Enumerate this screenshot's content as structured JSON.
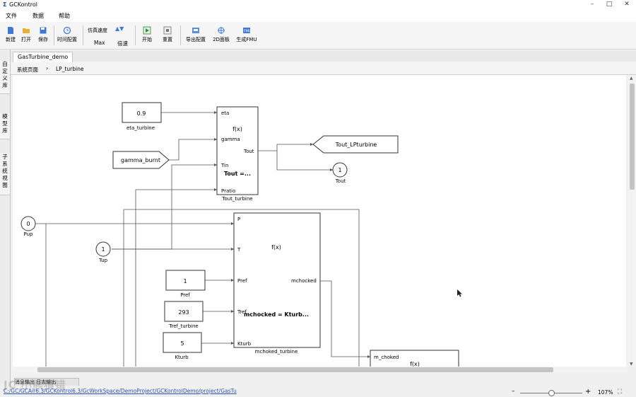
{
  "window": {
    "title": "GCKontrol",
    "app_icon": "Σ"
  },
  "menu": [
    "文件",
    "数据",
    "帮助"
  ],
  "toolbar": {
    "new": "新建",
    "open": "打开",
    "save": "保存",
    "time_config": "时间配置",
    "sim_speed_label": "仿真速度",
    "sim_speed_value": "Max",
    "mode": "倍速",
    "start": "开始",
    "reset": "重置",
    "export": "导出配置",
    "panel2d": "2D面板",
    "fmu": "生成FMU"
  },
  "left_dock": [
    "自定义库",
    "模型库",
    "子系统视图"
  ],
  "tabs": [
    "GasTurbine_demo"
  ],
  "breadcrumb": [
    "系统页面",
    "LP_turbine"
  ],
  "diagram": {
    "eta_value": "0.9",
    "eta_label": "eta_turbine",
    "gamma_in": "gamma_burnt",
    "tout_block": {
      "ports_in": [
        "eta",
        "gamma",
        "Tin",
        "Pratio"
      ],
      "port_out": "Tout",
      "fx": "f(x)",
      "expr": "Tout =...",
      "label": "Tout_turbine"
    },
    "goto_out": "Tout_LPturbine",
    "tout_port": {
      "num": "1",
      "label": "Tout"
    },
    "pup": {
      "num": "0",
      "label": "Pup"
    },
    "tup": {
      "num": "1",
      "label": "Tup"
    },
    "pref_value": "1",
    "pref_label": "Pref",
    "tref_value": "293",
    "tref_label": "Tref_turbine",
    "kturb_value": "5",
    "kturb_label": "Kturb",
    "mchoked_block": {
      "ports_in": [
        "P",
        "T",
        "Pref",
        "Tref",
        "Kturb"
      ],
      "port_out": "mchocked",
      "fx": "f(x)",
      "expr": "mchocked = Kturb...",
      "label": "mchoked_turbine"
    },
    "mchoked2": {
      "port_in": "m_choked",
      "fx": "f(x)"
    }
  },
  "status": {
    "path": "C:/GC/GCAir6.3/GCKontrol6.3/GcWorkSpace/DemoProject/GCKontrolDemo/project/GasTu",
    "watermark": "JC 小熊猜错",
    "bottom_tab": "消息输出  日志输出",
    "zoom": "107%"
  },
  "colors": {
    "link": "#2a55b8",
    "block_border": "#333333",
    "wire": "#555555",
    "accent_blue": "#2d6bd0"
  }
}
